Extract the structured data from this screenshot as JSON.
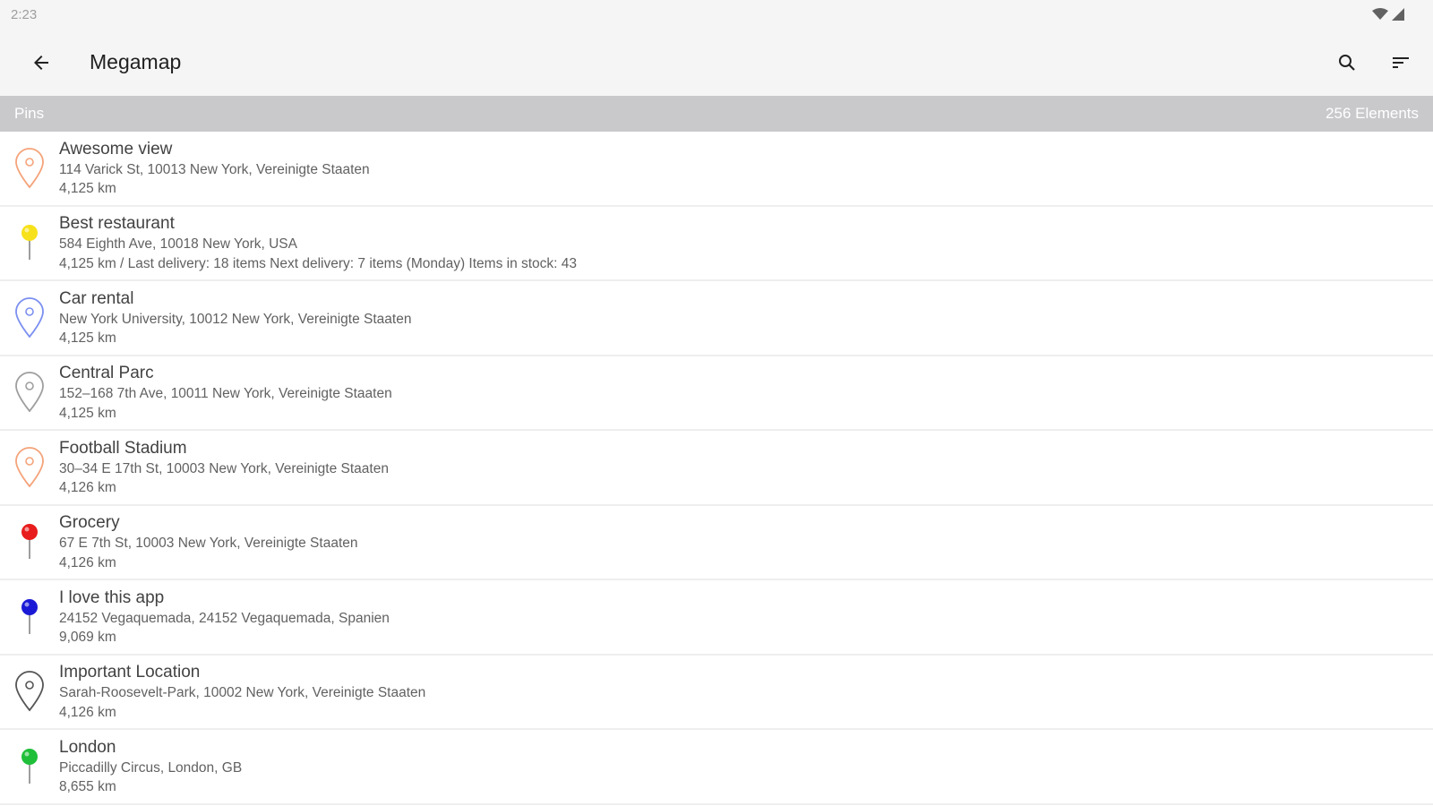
{
  "status": {
    "time": "2:23"
  },
  "appbar": {
    "title": "Megamap"
  },
  "section": {
    "label": "Pins",
    "count": "256 Elements"
  },
  "pins": [
    {
      "name": "Awesome view",
      "address": "114 Varick St, 10013 New York, Vereinigte Staaten",
      "info": "4,125 km",
      "style": "outline",
      "color": "#f4a37a",
      "icon": "map-pin-outline-icon"
    },
    {
      "name": "Best restaurant",
      "address": "584 Eighth Ave, 10018 New York, USA",
      "info": "4,125 km / Last delivery: 18 items Next delivery: 7 items (Monday) Items in stock: 43",
      "style": "push",
      "color": "#f7e11a",
      "icon": "pushpin-icon"
    },
    {
      "name": "Car rental",
      "address": "New York University, 10012 New York, Vereinigte Staaten",
      "info": "4,125 km",
      "style": "outline",
      "color": "#7b8ff0",
      "icon": "map-pin-outline-icon"
    },
    {
      "name": "Central Parc",
      "address": "152–168 7th Ave, 10011 New York, Vereinigte Staaten",
      "info": "4,125 km",
      "style": "outline",
      "color": "#9e9e9e",
      "icon": "map-pin-outline-icon"
    },
    {
      "name": "Football Stadium",
      "address": "30–34 E 17th St, 10003 New York, Vereinigte Staaten",
      "info": "4,126 km",
      "style": "outline",
      "color": "#f4a37a",
      "icon": "map-pin-outline-icon"
    },
    {
      "name": "Grocery",
      "address": "67 E 7th St, 10003 New York, Vereinigte Staaten",
      "info": "4,126 km",
      "style": "push",
      "color": "#e81c1c",
      "icon": "pushpin-icon"
    },
    {
      "name": "I love this app",
      "address": "24152 Vegaquemada, 24152 Vegaquemada, Spanien",
      "info": "9,069 km",
      "style": "push",
      "color": "#1a1ad6",
      "icon": "pushpin-icon"
    },
    {
      "name": "Important Location",
      "address": "Sarah-Roosevelt-Park, 10002 New York, Vereinigte Staaten",
      "info": "4,126 km",
      "style": "outline",
      "color": "#555555",
      "icon": "map-pin-outline-icon"
    },
    {
      "name": "London",
      "address": "Piccadilly Circus, London, GB",
      "info": "8,655 km",
      "style": "push",
      "color": "#1fbf3a",
      "icon": "pushpin-icon"
    }
  ]
}
